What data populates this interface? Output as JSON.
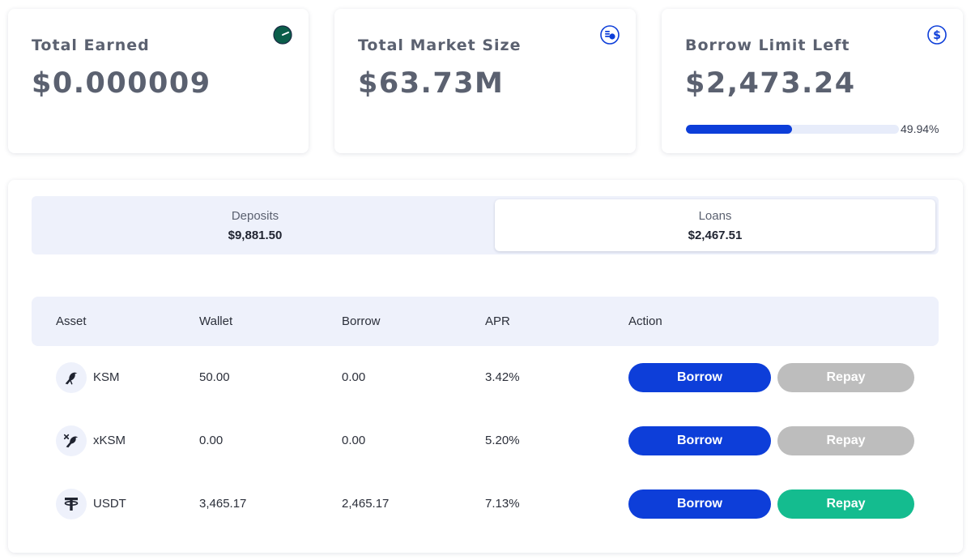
{
  "stats": {
    "total_earned": {
      "title": "Total Earned",
      "value": "$0.000009",
      "icon": "clock-icon"
    },
    "total_market_size": {
      "title": "Total Market Size",
      "value": "$63.73M",
      "icon": "coins-icon"
    },
    "borrow_limit_left": {
      "title": "Borrow Limit Left",
      "value": "$2,473.24",
      "icon": "dollar-icon",
      "progress_label": "49.94%",
      "progress_fraction": 0.4994
    }
  },
  "switcher": {
    "deposits": {
      "label": "Deposits",
      "amount": "$9,881.50"
    },
    "loans": {
      "label": "Loans",
      "amount": "$2,467.51",
      "selected": true
    }
  },
  "table": {
    "headers": [
      "Asset",
      "Wallet",
      "Borrow",
      "APR",
      "Action"
    ],
    "rows": [
      {
        "asset": "KSM",
        "icon": "ksm-bird-icon",
        "wallet": "50.00",
        "borrow": "0.00",
        "apr": "3.42%",
        "borrow_label": "Borrow",
        "repay_label": "Repay",
        "repay_enabled": false
      },
      {
        "asset": "xKSM",
        "icon": "xksm-bird-icon",
        "wallet": "0.00",
        "borrow": "0.00",
        "apr": "5.20%",
        "borrow_label": "Borrow",
        "repay_label": "Repay",
        "repay_enabled": false
      },
      {
        "asset": "USDT",
        "icon": "tether-icon",
        "wallet": "3,465.17",
        "borrow": "2,465.17",
        "apr": "7.13%",
        "borrow_label": "Borrow",
        "repay_label": "Repay",
        "repay_enabled": true
      }
    ]
  },
  "colors": {
    "primary": "#0d3ed9",
    "success": "#14bc8f",
    "disabled": "#bdbdbd",
    "muted_bg": "#eef1fb",
    "clock_icon": "#0b5e4a"
  }
}
